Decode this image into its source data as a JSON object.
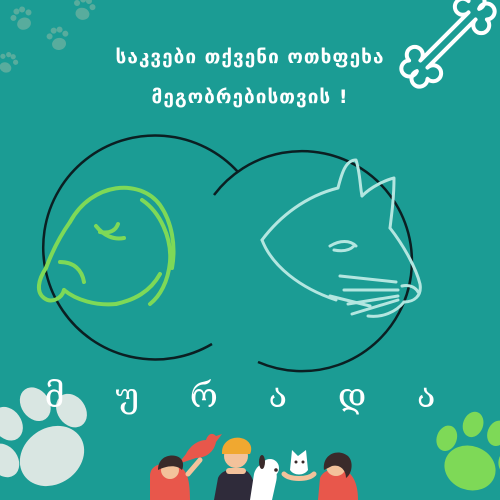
{
  "headline": {
    "line_1": "საკვები თქვენი ოთხფეხა",
    "line_2": "მეგობრებისთვის !"
  },
  "brand": {
    "name": "მ უ რ ა დ ა"
  },
  "colors": {
    "background": "#1b9c94",
    "dog_outline": "#7ed957",
    "cat_outline": "#b3e6e0",
    "paw_light": "#d9e6e2",
    "paw_green": "#7ed957",
    "arc_line": "#0b1f22",
    "text": "#ffffff"
  },
  "icons": [
    "paw-icon",
    "bone-icon",
    "dog-head-icon",
    "cat-head-icon",
    "people-with-pets-illustration"
  ]
}
